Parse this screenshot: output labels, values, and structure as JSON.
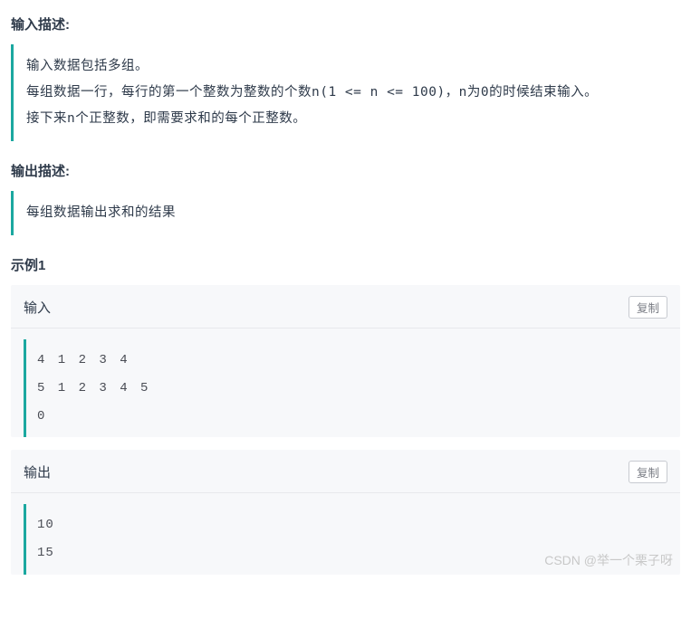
{
  "input_desc": {
    "heading": "输入描述:",
    "lines": [
      "输入数据包括多组。",
      "每组数据一行，每行的第一个整数为整数的个数n(1 <= n <= 100)，n为0的时候结束输入。",
      "接下来n个正整数，即需要求和的每个正整数。"
    ]
  },
  "output_desc": {
    "heading": "输出描述:",
    "text": "每组数据输出求和的结果"
  },
  "example": {
    "heading": "示例1",
    "input_label": "输入",
    "output_label": "输出",
    "copy_label": "复制",
    "input_code": "4 1 2 3 4\n5 1 2 3 4 5\n0",
    "output_code": "10\n15"
  },
  "watermark": "CSDN @举一个栗子呀"
}
